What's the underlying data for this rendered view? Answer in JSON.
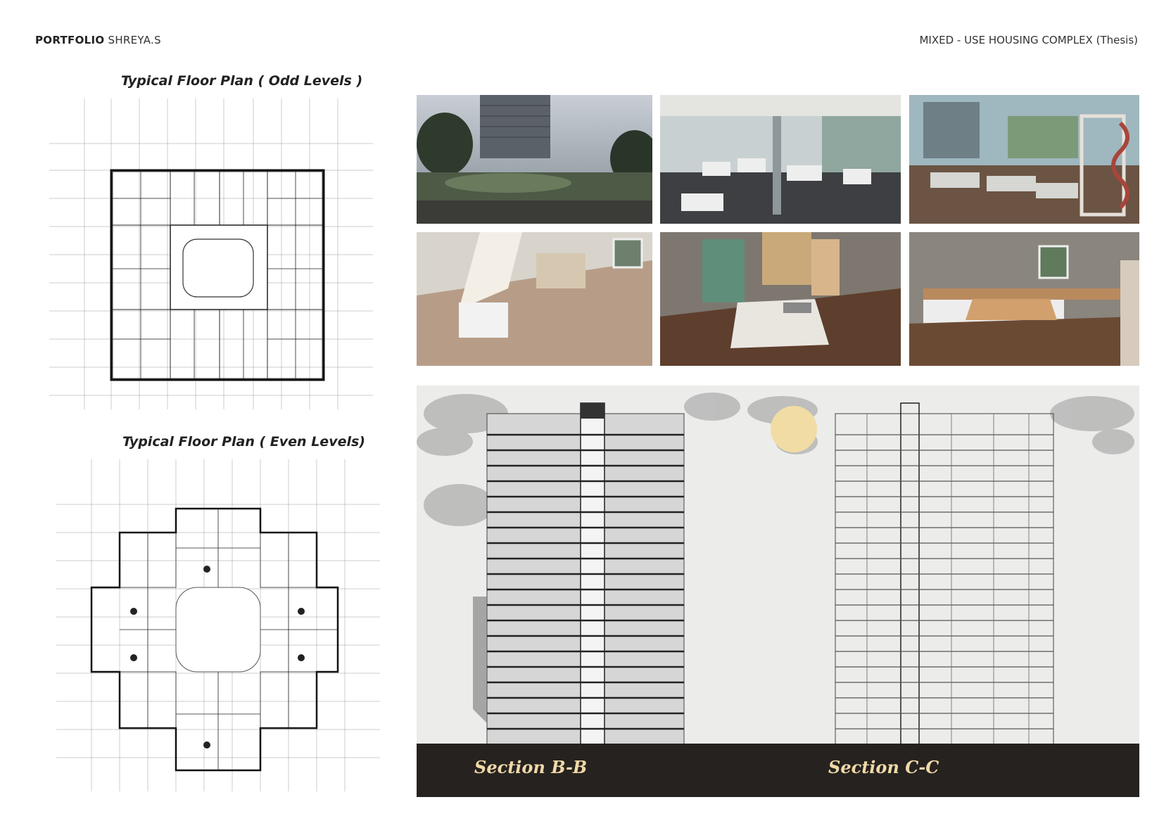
{
  "header": {
    "portfolio_label": "PORTFOLIO",
    "author": "SHREYA.S",
    "project_title": "MIXED - USE HOUSING COMPLEX (Thesis)"
  },
  "plans": {
    "odd_title": "Typical Floor Plan ( Odd Levels )",
    "even_title": "Typical Floor Plan ( Even Levels)"
  },
  "renders": [
    {
      "subject": "exterior-tower-view"
    },
    {
      "subject": "interior-gym-floor"
    },
    {
      "subject": "interior-gym-treadmills"
    },
    {
      "subject": "living-dining-room"
    },
    {
      "subject": "bedroom"
    },
    {
      "subject": "kitchen"
    }
  ],
  "sections": {
    "left_label": "Section B-B",
    "right_label": "Section C-C"
  },
  "colors": {
    "footer_bg": "#26221f",
    "label_text": "#efd9a8",
    "sun": "#f1dca4"
  }
}
